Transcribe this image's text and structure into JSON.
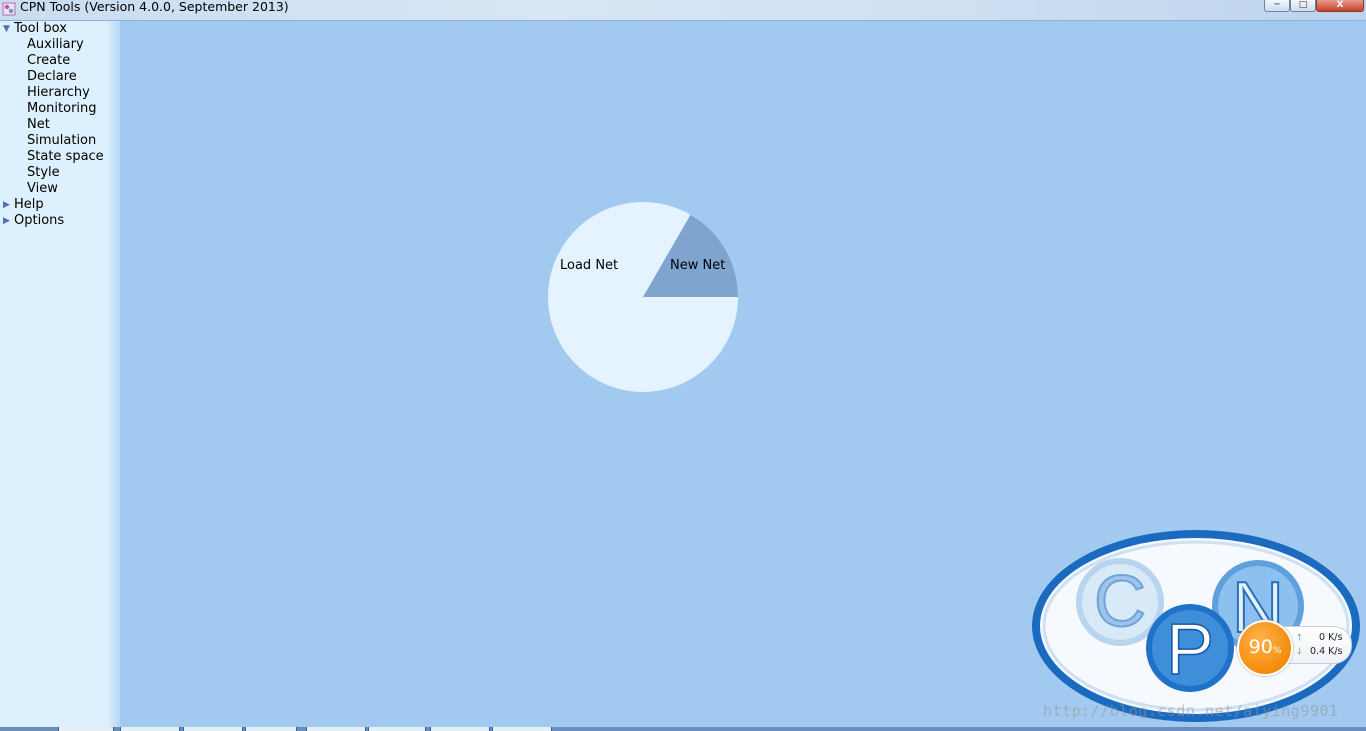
{
  "window": {
    "title": "CPN Tools (Version 4.0.0, September 2013)",
    "controls": {
      "minimize": "─",
      "maximize": "□",
      "close": "X"
    }
  },
  "sidebar": {
    "toolbox": {
      "label": "Tool box",
      "expanded": true,
      "items": [
        "Auxiliary",
        "Create",
        "Declare",
        "Hierarchy",
        "Monitoring",
        "Net",
        "Simulation",
        "State space",
        "Style",
        "View"
      ]
    },
    "help": {
      "label": "Help",
      "expanded": false
    },
    "options": {
      "label": "Options",
      "expanded": false
    }
  },
  "pie_menu": {
    "load_net": "Load Net",
    "new_net": "New Net"
  },
  "logo": {
    "letters": [
      "C",
      "P",
      "N"
    ],
    "colors": {
      "ring": "#1a6bc0",
      "fill": "#ffffff",
      "letters": "#2a83d6"
    }
  },
  "net_monitor": {
    "percent": "90",
    "percent_unit": "%",
    "upload": "0 K/s",
    "download": "0.4 K/s"
  },
  "watermark": "http://blog.csdn.net/aiying9901",
  "colors": {
    "workspace": "#a2c9ef",
    "sidebar": "#dcf1fd",
    "pie_light": "#e4f3fd",
    "pie_dark": "#7ea4cf"
  }
}
